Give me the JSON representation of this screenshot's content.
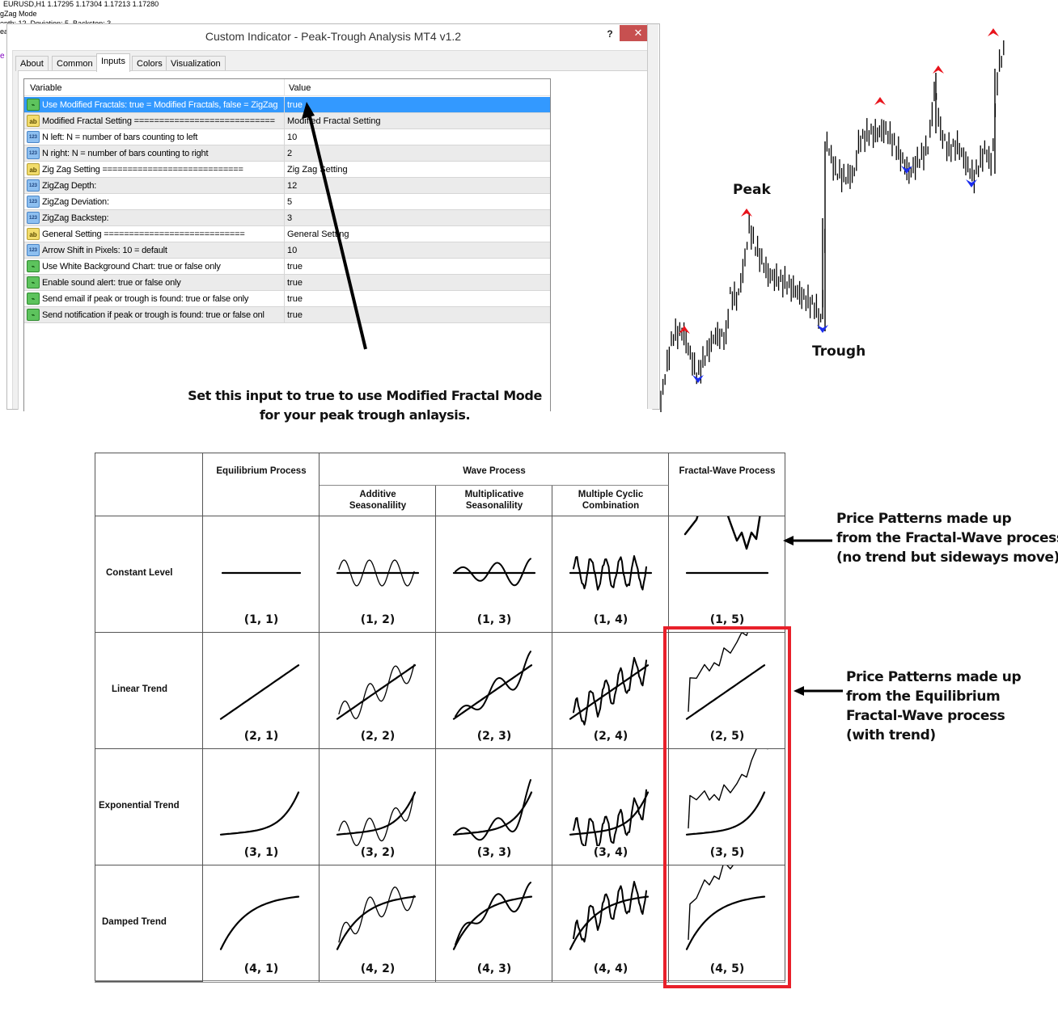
{
  "chart_header": {
    "symbol_line": "EURUSD,H1  1.17295 1.17304 1.17213 1.17280",
    "mode_line": "gZag Mode",
    "params_line": "epth: 12, Deviation: 5, Backstep: 3",
    "fragment": "ea",
    "purple_fragment": "e"
  },
  "dialog": {
    "title": "Custom Indicator - Peak-Trough Analysis MT4 v1.2",
    "help_label": "?",
    "close_label": "✕",
    "tabs": [
      {
        "label": "About",
        "active": false
      },
      {
        "label": "Common",
        "active": false
      },
      {
        "label": "Inputs",
        "active": true
      },
      {
        "label": "Colors",
        "active": false
      },
      {
        "label": "Visualization",
        "active": false
      }
    ],
    "grid": {
      "columns": [
        "Variable",
        "Value"
      ],
      "rows": [
        {
          "icon": "bool",
          "variable": "Use Modified Fractals: true = Modified Fractals, false = ZigZag",
          "value": "true",
          "selected": true
        },
        {
          "icon": "str",
          "variable": "Modified Fractal Setting ============================",
          "value": "Modified Fractal Setting"
        },
        {
          "icon": "num",
          "variable": "N left:   N = number of bars counting to left",
          "value": "10"
        },
        {
          "icon": "num",
          "variable": "N right:  N = number of bars counting to right",
          "value": "2"
        },
        {
          "icon": "str",
          "variable": "Zig Zag Setting ============================",
          "value": "Zig Zag Setting"
        },
        {
          "icon": "num",
          "variable": "ZigZag Depth:",
          "value": "12"
        },
        {
          "icon": "num",
          "variable": "ZigZag Deviation:",
          "value": "5"
        },
        {
          "icon": "num",
          "variable": "ZigZag Backstep:",
          "value": "3"
        },
        {
          "icon": "str",
          "variable": "General Setting ============================",
          "value": "General Setting"
        },
        {
          "icon": "num",
          "variable": "Arrow Shift in Pixels: 10 = default",
          "value": "10"
        },
        {
          "icon": "bool",
          "variable": "Use White Background Chart: true or false only",
          "value": "true"
        },
        {
          "icon": "bool",
          "variable": "Enable sound alert: true or false only",
          "value": "true"
        },
        {
          "icon": "bool",
          "variable": "Send email if peak or trough is found: true or false only",
          "value": "true"
        },
        {
          "icon": "bool",
          "variable": "Send notification if peak or trough is found: true or false onl",
          "value": "true"
        }
      ]
    },
    "icon_glyphs": {
      "bool": "⌁",
      "str": "ab",
      "num": "123"
    },
    "annotation_line1": "Set this input to true to use Modified Fractal Mode",
    "annotation_line2": "for your peak trough anlaysis."
  },
  "price_chart": {
    "peak_label": "Peak",
    "trough_label": "Trough",
    "colors": {
      "peak_arrow": "#e8141c",
      "trough_arrow": "#1a2cf0",
      "bars": "#000000"
    }
  },
  "process_table": {
    "headers": {
      "equilibrium": "Equilibrium Process",
      "wave": "Wave Process",
      "fractal_wave": "Fractal-Wave Process",
      "sub": [
        "Additive\nSeasonalility",
        "Multiplicative\nSeasonalility",
        "Multiple Cyclic\nCombination"
      ]
    },
    "sub_line1": [
      "Additive",
      "Multiplicative",
      "Multiple Cyclic"
    ],
    "sub_line2": [
      "Seasonalility",
      "Seasonalility",
      "Combination"
    ],
    "rows": [
      {
        "label": "Constant Level",
        "cells": [
          "(1, 1)",
          "(1, 2)",
          "(1, 3)",
          "(1, 4)",
          "(1, 5)"
        ]
      },
      {
        "label": "Linear Trend",
        "cells": [
          "(2, 1)",
          "(2, 2)",
          "(2, 3)",
          "(2, 4)",
          "(2, 5)"
        ]
      },
      {
        "label": "Exponential Trend",
        "cells": [
          "(3, 1)",
          "(3, 2)",
          "(3, 3)",
          "(3, 4)",
          "(3, 5)"
        ]
      },
      {
        "label": "Damped Trend",
        "cells": [
          "(4, 1)",
          "(4, 2)",
          "(4, 3)",
          "(4, 4)",
          "(4, 5)"
        ]
      }
    ],
    "highlight_color": "#e8202a"
  },
  "notes": {
    "fractal_wave": [
      "Price Patterns made up",
      "from the Fractal-Wave process",
      "(no trend but sideways move)"
    ],
    "equilibrium_fractal_wave": [
      "Price Patterns made up",
      "from the Equilibrium",
      "Fractal-Wave process",
      "(with trend)"
    ]
  }
}
